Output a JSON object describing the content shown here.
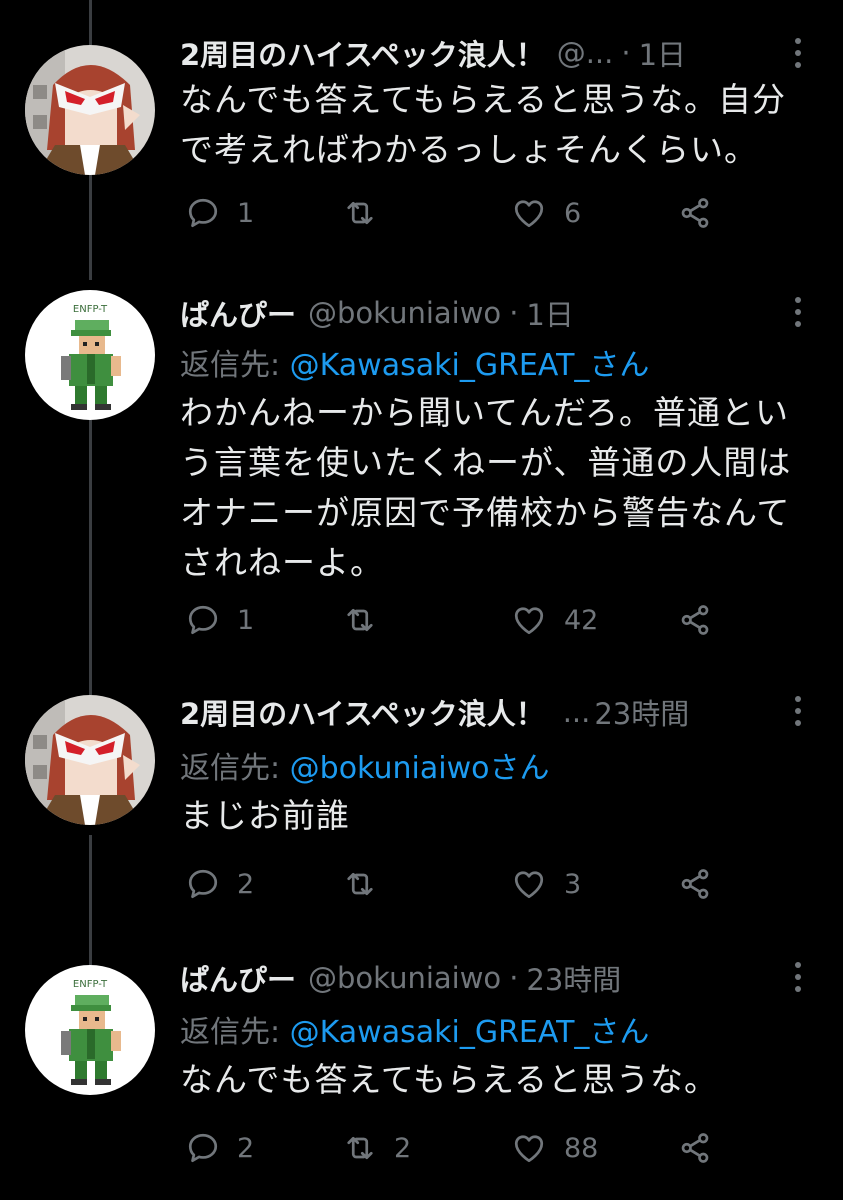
{
  "tweets": [
    {
      "name": "2周目のハイスペック浪人！",
      "handle": "@...",
      "sep": "·",
      "time": "1日",
      "reply_prefix": "",
      "reply_mention": "",
      "lines": [
        "なんでも答えてもらえると思うな。自分",
        "で考えればわかるっしょそんくらい。"
      ],
      "replies": "1",
      "retweets": "",
      "likes": "6",
      "avatar": "anime-girl-mask-avatar"
    },
    {
      "name": "ぱんぴー",
      "handle": "@bokuniaiwo",
      "sep": "·",
      "time": "1日",
      "reply_prefix": "返信先: ",
      "reply_mention": "@Kawasaki_GREAT_さん",
      "lines": [
        "わかんねーから聞いてんだろ。普通とい",
        "う言葉を使いたくねーが、普通の人間は",
        "オナニーが原因で予備校から警告なんて",
        "されねーよ。"
      ],
      "replies": "1",
      "retweets": "",
      "likes": "42",
      "avatar": "pixel-character-avatar",
      "avatar_label": "ENFP-T"
    },
    {
      "name": "2周目のハイスペック浪人！",
      "handle": "...",
      "sep": "",
      "time": "23時間",
      "reply_prefix": "返信先: ",
      "reply_mention": "@bokuniaiwoさん",
      "lines": [
        "まじお前誰"
      ],
      "replies": "2",
      "retweets": "",
      "likes": "3",
      "avatar": "anime-girl-mask-avatar"
    },
    {
      "name": "ぱんぴー",
      "handle": "@bokuniaiwo",
      "sep": "·",
      "time": "23時間",
      "reply_prefix": "返信先: ",
      "reply_mention": "@Kawasaki_GREAT_さん",
      "lines": [
        "なんでも答えてもらえると思うな。"
      ],
      "replies": "2",
      "retweets": "2",
      "likes": "88",
      "avatar": "pixel-character-avatar",
      "avatar_label": "ENFP-T"
    }
  ],
  "colors": {
    "background": "#000000",
    "text": "#e7e9ea",
    "muted": "#71767b",
    "link": "#1d9bf0",
    "thread_line": "#3a3d41"
  }
}
